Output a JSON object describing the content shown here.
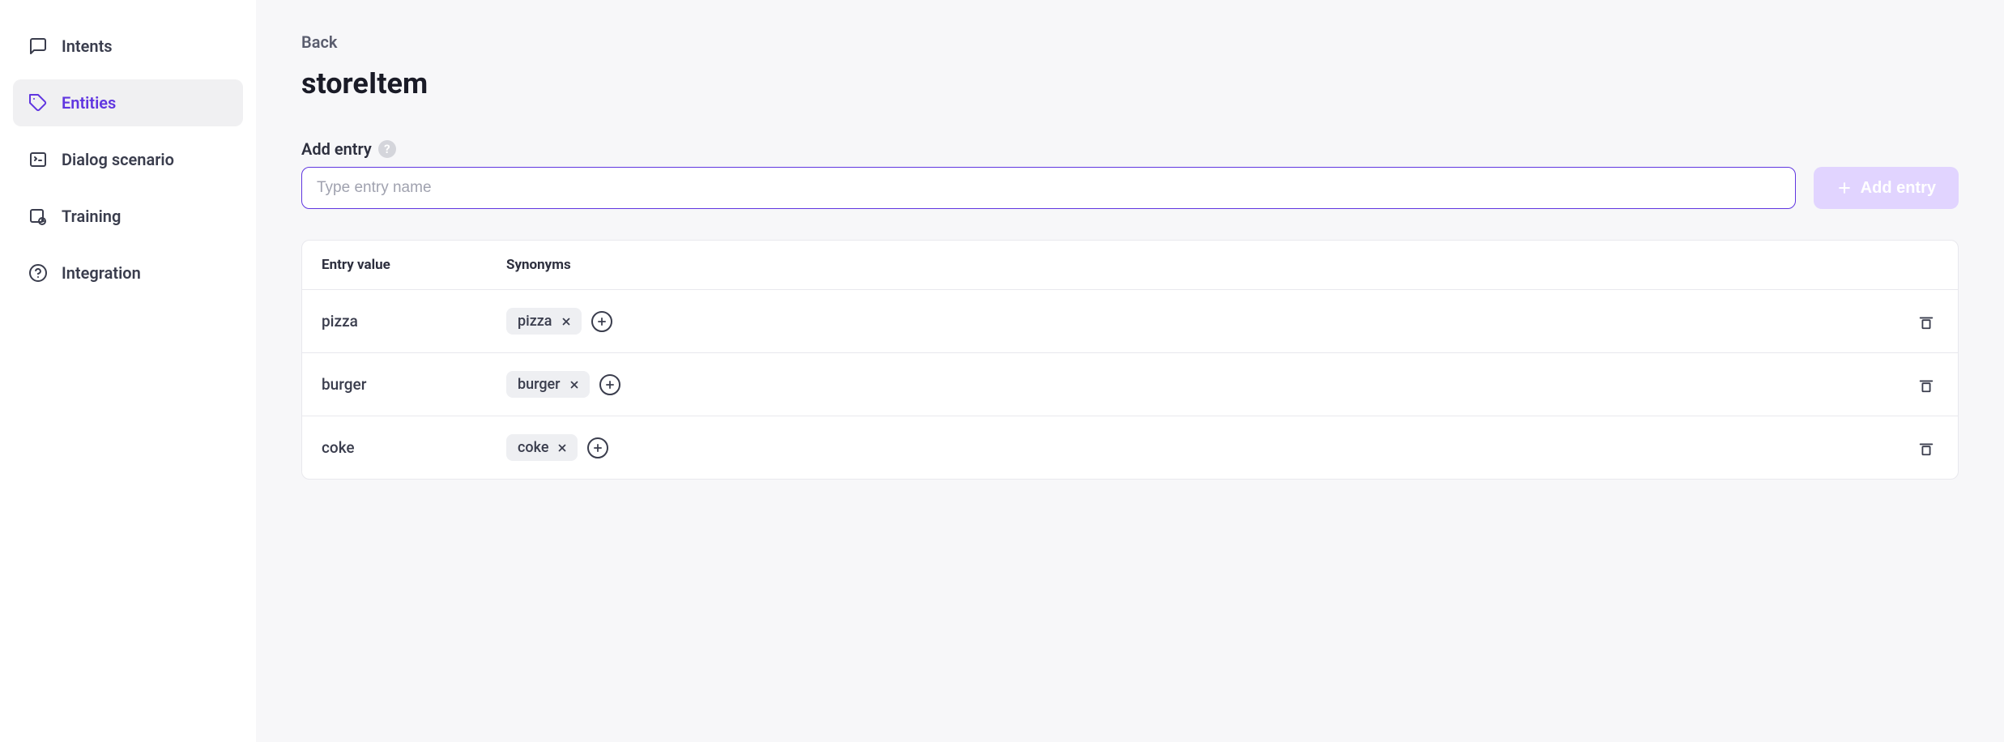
{
  "sidebar": {
    "items": [
      {
        "label": "Intents",
        "icon": "chat-icon",
        "active": false
      },
      {
        "label": "Entities",
        "icon": "tag-icon",
        "active": true
      },
      {
        "label": "Dialog scenario",
        "icon": "terminal-icon",
        "active": false
      },
      {
        "label": "Training",
        "icon": "training-icon",
        "active": false
      },
      {
        "label": "Integration",
        "icon": "help-circle-icon",
        "active": false
      }
    ]
  },
  "main": {
    "back_label": "Back",
    "title": "storeItem",
    "add_entry_label": "Add entry",
    "entry_input_placeholder": "Type entry name",
    "add_entry_button_label": "Add entry",
    "table": {
      "header_entry_value": "Entry value",
      "header_synonyms": "Synonyms",
      "rows": [
        {
          "value": "pizza",
          "synonyms": [
            "pizza"
          ]
        },
        {
          "value": "burger",
          "synonyms": [
            "burger"
          ]
        },
        {
          "value": "coke",
          "synonyms": [
            "coke"
          ]
        }
      ]
    }
  },
  "colors": {
    "accent": "#6036e0",
    "sidebar_active_bg": "#f0f0f2",
    "main_bg": "#f7f7f9",
    "add_button_bg": "#e1d4ff",
    "chip_bg": "#eeeff2"
  }
}
